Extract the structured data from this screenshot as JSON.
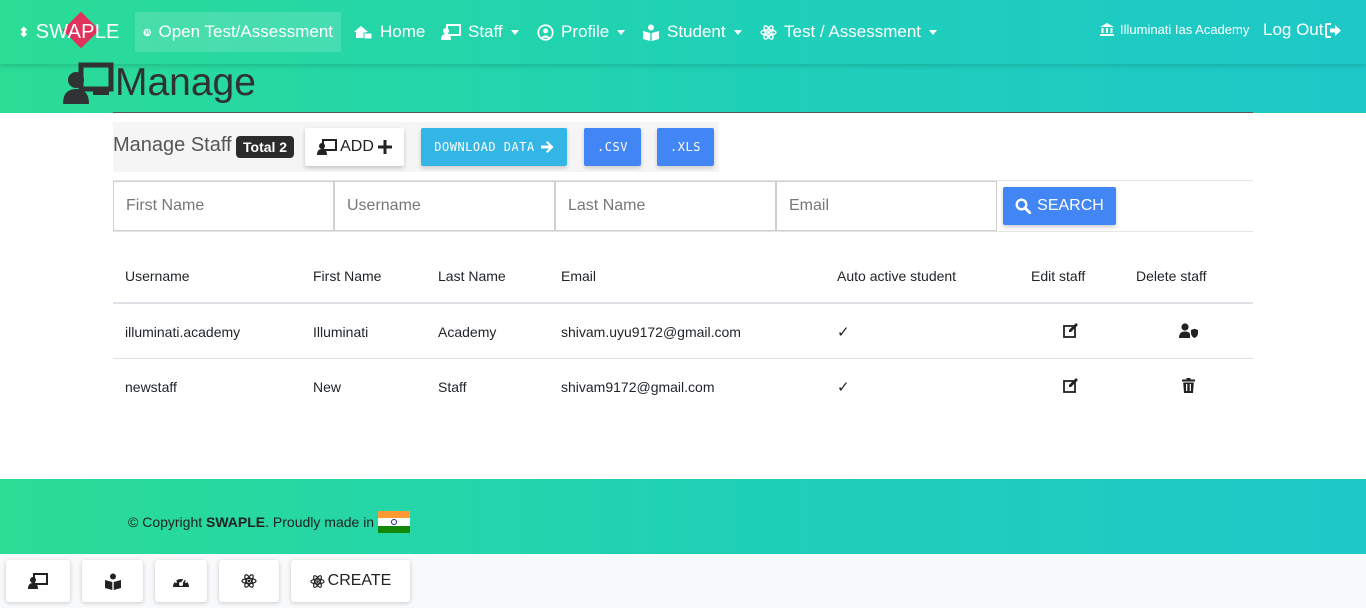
{
  "navbar": {
    "brand": "SWAPLE",
    "items": [
      {
        "label": "Open Test/Assessment",
        "icon": "globe-icon",
        "dropdown": false
      },
      {
        "label": "Home",
        "icon": "home-network-icon",
        "dropdown": false
      },
      {
        "label": "Staff",
        "icon": "staff-board-icon",
        "dropdown": true
      },
      {
        "label": "Profile",
        "icon": "user-circle-icon",
        "dropdown": true
      },
      {
        "label": "Student",
        "icon": "book-reader-icon",
        "dropdown": true
      },
      {
        "label": "Test / Assessment",
        "icon": "atom-icon",
        "dropdown": true
      }
    ],
    "academy": "Illuminati Ias Academy",
    "logout": "Log Out"
  },
  "page": {
    "title": "Manage"
  },
  "toolbar": {
    "label": "Manage Staff",
    "total_badge": "Total 2",
    "add_label": "ADD",
    "download_label": "DOWNLOAD DATA",
    "csv_label": ".CSV",
    "xls_label": ".XLS"
  },
  "search": {
    "first_name_placeholder": "First Name",
    "username_placeholder": "Username",
    "last_name_placeholder": "Last Name",
    "email_placeholder": "Email",
    "button_label": "SEARCH"
  },
  "table": {
    "headers": [
      "Username",
      "First Name",
      "Last Name",
      "Email",
      "Auto active student",
      "Edit staff",
      "Delete staff"
    ],
    "rows": [
      {
        "username": "illuminati.academy",
        "first_name": "Illuminati",
        "last_name": "Academy",
        "email": "shivam.uyu9172@gmail.com",
        "auto_active": "✓",
        "delete_icon": "user-shield-icon"
      },
      {
        "username": "newstaff",
        "first_name": "New",
        "last_name": "Staff",
        "email": "shivam9172@gmail.com",
        "auto_active": "✓",
        "delete_icon": "trash-icon"
      }
    ]
  },
  "footer": {
    "copyright": "© Copyright",
    "brand": "SWAPLE",
    "made_in": ". Proudly made in"
  },
  "bottom_bar": {
    "create_label": "CREATE"
  },
  "colors": {
    "gradient_start": "#2bdc95",
    "gradient_end": "#1ec8c8",
    "primary": "#4285f4",
    "info": "#33b5e5",
    "brand_diamond": "#e0325a"
  }
}
